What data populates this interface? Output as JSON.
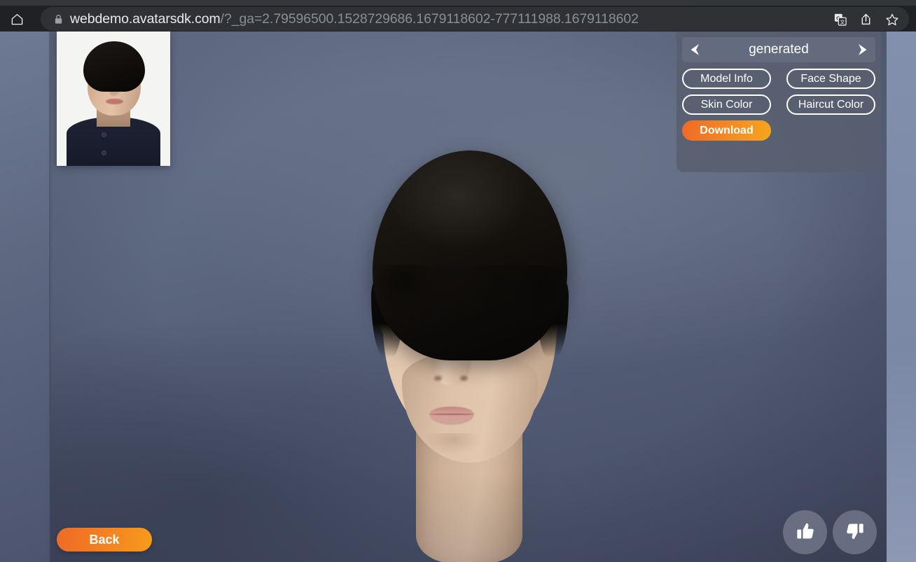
{
  "browser": {
    "home_icon": "home-icon",
    "lock_icon": "lock-icon",
    "url_host": "webdemo.avatarsdk.com",
    "url_path": "/?_ga=2.79596500.1528729686.1679118602-777111988.1679118602",
    "url_full": "webdemo.avatarsdk.com/?_ga=2.79596500.1528729686.1679118602-777111988.1679118602",
    "actions": [
      {
        "name": "translate-icon",
        "label": "Translate this page"
      },
      {
        "name": "share-icon",
        "label": "Share this page"
      },
      {
        "name": "bookmark-star-icon",
        "label": "Bookmark this tab"
      }
    ]
  },
  "panel": {
    "prev_arrow": "chevron-left-icon",
    "next_arrow": "chevron-right-icon",
    "avatar_name": "generated",
    "buttons": [
      {
        "label": "Model Info",
        "name": "model-info-button",
        "style": "outline"
      },
      {
        "label": "Face Shape",
        "name": "face-shape-button",
        "style": "outline"
      },
      {
        "label": "Skin Color",
        "name": "skin-color-button",
        "style": "outline"
      },
      {
        "label": "Haircut Color",
        "name": "haircut-color-button",
        "style": "outline"
      },
      {
        "label": "Download",
        "name": "download-button",
        "style": "primary"
      }
    ]
  },
  "viewport": {
    "back_label": "Back",
    "thumbnail_name": "source-photo-thumbnail",
    "avatar_name": "avatar-3d-model",
    "feedback": [
      {
        "name": "thumbs-up-button",
        "label": "Good result"
      },
      {
        "name": "thumbs-down-button",
        "label": "Bad result"
      }
    ]
  },
  "colors": {
    "accent_orange_start": "#ef6a26",
    "accent_orange_end": "#f7a51d",
    "panel_bg": "#585f70",
    "viewport_bg": "#5a6379",
    "page_bg": "#838fac",
    "chrome_bg": "#202124",
    "omnibox_bg": "#2f3134",
    "url_host_color": "#e8eaed",
    "url_path_color": "#8a8f94"
  }
}
